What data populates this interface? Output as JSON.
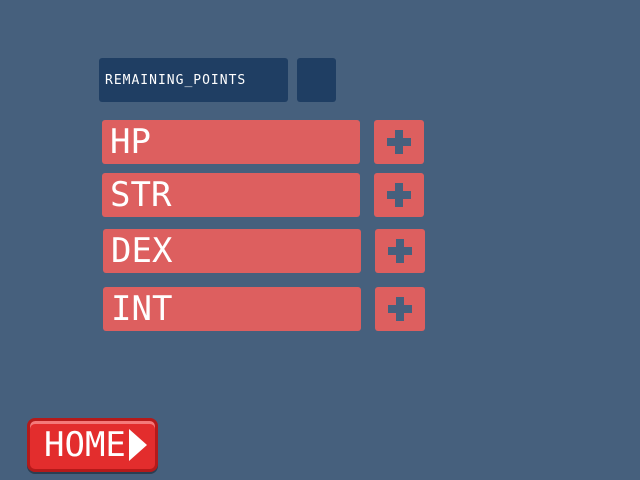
{
  "remaining": {
    "label": "REMAINING_POINTS",
    "value": ""
  },
  "stats": [
    {
      "label": "HP",
      "button_icon": "plus-icon"
    },
    {
      "label": "STR",
      "button_icon": "plus-icon"
    },
    {
      "label": "DEX",
      "button_icon": "plus-icon"
    },
    {
      "label": "INT",
      "button_icon": "plus-icon"
    }
  ],
  "home": {
    "label": "HOME",
    "icon": "play-arrow-icon"
  },
  "colors": {
    "background": "#46607d",
    "panel": "#1f3e63",
    "stat": "#dd5f5f",
    "plus_icon": "#46607d",
    "home_button": "#e32d2d"
  }
}
